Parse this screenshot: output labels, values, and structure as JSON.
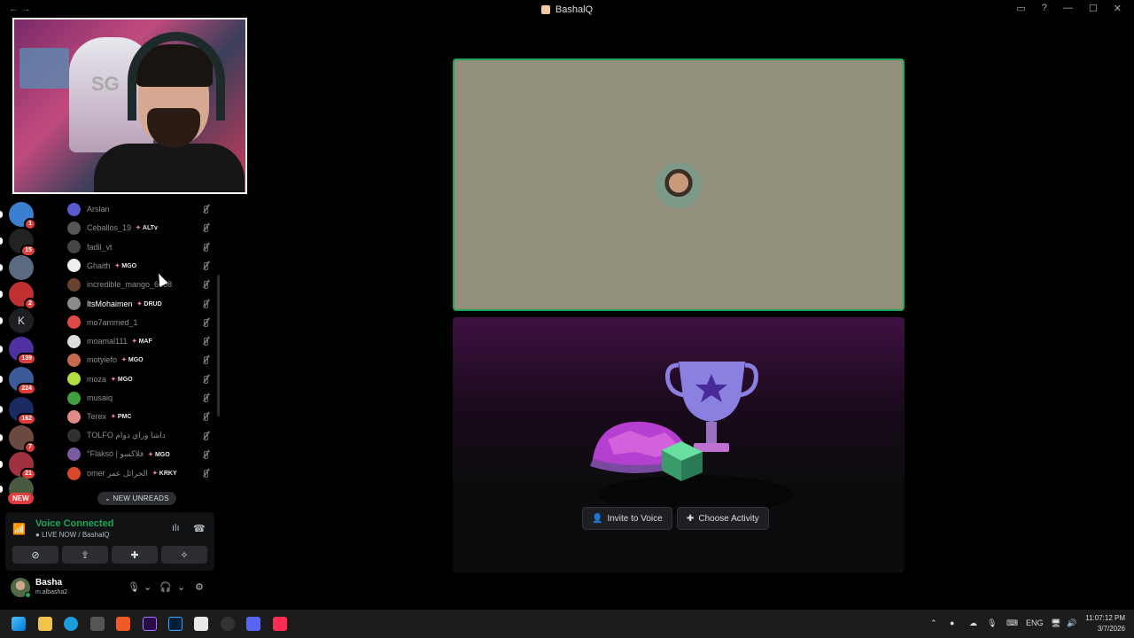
{
  "window": {
    "title": "BashalQ",
    "nav": "← →"
  },
  "servers": [
    {
      "badge": "1",
      "color": "#3a7fd0"
    },
    {
      "badge": "15",
      "color": "#222222"
    },
    {
      "badge": "",
      "color": "#5a6a80"
    },
    {
      "badge": "2",
      "color": "#c03030"
    },
    {
      "letter": "K",
      "color": "#1e1f22"
    },
    {
      "badge": "139",
      "color": "#5030a0"
    },
    {
      "badge": "224",
      "color": "#3a5a9a"
    },
    {
      "badge": "162",
      "color": "#1a2a60"
    },
    {
      "badge": "7",
      "color": "#6a4a40"
    },
    {
      "badge": "21",
      "color": "#a03040"
    },
    {
      "badge": "",
      "color": "#4a5a40"
    }
  ],
  "servers_new_label": "NEW",
  "members": [
    {
      "name": "Arslan",
      "tag": "",
      "color": "#5a5ad0"
    },
    {
      "name": "Ceballos_19",
      "tag": "ALTv",
      "color": "#555555"
    },
    {
      "name": "fadil_vt",
      "tag": "",
      "color": "#444444"
    },
    {
      "name": "Ghaith",
      "tag": "MGO",
      "color": "#eeeeee"
    },
    {
      "name": "incredible_mango_6608",
      "tag": "",
      "color": "#6a4030"
    },
    {
      "name": "ItsMohaimen",
      "tag": "DRUD",
      "color": "#8a8a8a",
      "active": true
    },
    {
      "name": "mo7ammed_1",
      "tag": "",
      "color": "#e04848"
    },
    {
      "name": "moamal111",
      "tag": "MAF",
      "color": "#dddddd"
    },
    {
      "name": "motyiefo",
      "tag": "MGO",
      "color": "#c86a50"
    },
    {
      "name": "moza",
      "tag": "MGO",
      "color": "#b0e040"
    },
    {
      "name": "musaiq",
      "tag": "",
      "color": "#40a040"
    },
    {
      "name": "Terex",
      "tag": "PMC",
      "color": "#e08a8a"
    },
    {
      "name": "TOLFO داشا وراي دوام",
      "tag": "",
      "color": "#303030"
    },
    {
      "name": "°Flakso | فلاكسو",
      "tag": "MGO",
      "color": "#7a5aa0"
    },
    {
      "name": "omer الجزائل عمر",
      "tag": "KRKY",
      "color": "#d84a2a"
    }
  ],
  "new_unreads": "NEW UNREADS",
  "voice": {
    "status": "Voice Connected",
    "channel": "LIVE NOW / BashalQ"
  },
  "user": {
    "name": "Basha",
    "status": "m.albasha2"
  },
  "stage": {
    "invite_label": "Invite to Voice",
    "activity_label": "Choose Activity"
  },
  "tray": {
    "lang": "ENG",
    "time": "11:07:12 PM",
    "date": "3/7/2026"
  }
}
